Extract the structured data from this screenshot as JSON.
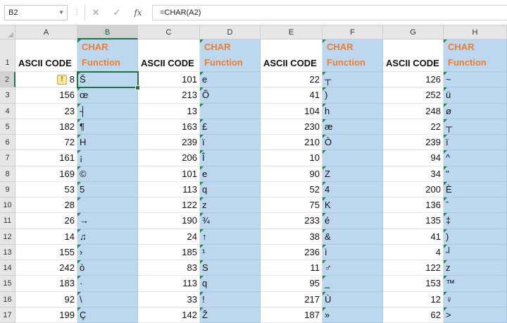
{
  "formula_bar": {
    "name_box": "B2",
    "cancel_glyph": "✕",
    "enter_glyph": "✓",
    "fx_label": "fx",
    "formula": "=CHAR(A2)"
  },
  "columns": [
    "A",
    "B",
    "C",
    "D",
    "E",
    "F",
    "G",
    "H"
  ],
  "selected_column": "B",
  "rows": [
    "1",
    "2",
    "3",
    "4",
    "5",
    "6",
    "7",
    "8",
    "9",
    "10",
    "11",
    "12",
    "13",
    "14",
    "15",
    "16",
    "17"
  ],
  "selected_row": "2",
  "active_cell": "B2",
  "colors": {
    "char_fill": "#bdd7ee",
    "char_header": "#ed7d31",
    "select": "#217346"
  },
  "headers": {
    "code_label": "ASCII CODE",
    "char_label_1": "CHAR",
    "char_label_2": "Function"
  },
  "data": [
    [
      [
        "8",
        "Š"
      ],
      [
        "101",
        "e"
      ],
      [
        "22",
        "┬"
      ],
      [
        "126",
        "~"
      ]
    ],
    [
      [
        "156",
        "œ"
      ],
      [
        "213",
        "Õ"
      ],
      [
        "41",
        ")"
      ],
      [
        "252",
        "ü"
      ]
    ],
    [
      [
        "23",
        "┤"
      ],
      [
        "13",
        ""
      ],
      [
        "104",
        "h"
      ],
      [
        "248",
        "ø"
      ]
    ],
    [
      [
        "182",
        "¶"
      ],
      [
        "163",
        "£"
      ],
      [
        "230",
        "æ"
      ],
      [
        "22",
        "┬"
      ]
    ],
    [
      [
        "72",
        "H"
      ],
      [
        "239",
        "ï"
      ],
      [
        "210",
        "Ò"
      ],
      [
        "239",
        "ï"
      ]
    ],
    [
      [
        "161",
        "¡"
      ],
      [
        "206",
        "Î"
      ],
      [
        "10",
        ""
      ],
      [
        "94",
        "^"
      ]
    ],
    [
      [
        "169",
        "©"
      ],
      [
        "101",
        "e"
      ],
      [
        "90",
        "Z"
      ],
      [
        "34",
        "\""
      ]
    ],
    [
      [
        "53",
        "5"
      ],
      [
        "113",
        "q"
      ],
      [
        "52",
        "4"
      ],
      [
        "200",
        "È"
      ]
    ],
    [
      [
        "28",
        ""
      ],
      [
        "122",
        "z"
      ],
      [
        "75",
        "K"
      ],
      [
        "136",
        "ˆ"
      ]
    ],
    [
      [
        "26",
        "→"
      ],
      [
        "190",
        "¾"
      ],
      [
        "233",
        "é"
      ],
      [
        "135",
        "‡"
      ]
    ],
    [
      [
        "14",
        "♫"
      ],
      [
        "24",
        "↑"
      ],
      [
        "38",
        "&"
      ],
      [
        "41",
        ")"
      ]
    ],
    [
      [
        "155",
        "›"
      ],
      [
        "185",
        "¹"
      ],
      [
        "236",
        "ì"
      ],
      [
        "4",
        "┘"
      ]
    ],
    [
      [
        "242",
        "ò"
      ],
      [
        "83",
        "S"
      ],
      [
        "11",
        "♂"
      ],
      [
        "122",
        "z"
      ]
    ],
    [
      [
        "183",
        "·"
      ],
      [
        "113",
        "q"
      ],
      [
        "95",
        "_"
      ],
      [
        "153",
        "™"
      ]
    ],
    [
      [
        "92",
        "\\"
      ],
      [
        "33",
        "!"
      ],
      [
        "217",
        "Ù"
      ],
      [
        "12",
        "♀"
      ]
    ],
    [
      [
        "199",
        "Ç"
      ],
      [
        "142",
        "Ž"
      ],
      [
        "187",
        "»"
      ],
      [
        "62",
        ">"
      ]
    ]
  ]
}
